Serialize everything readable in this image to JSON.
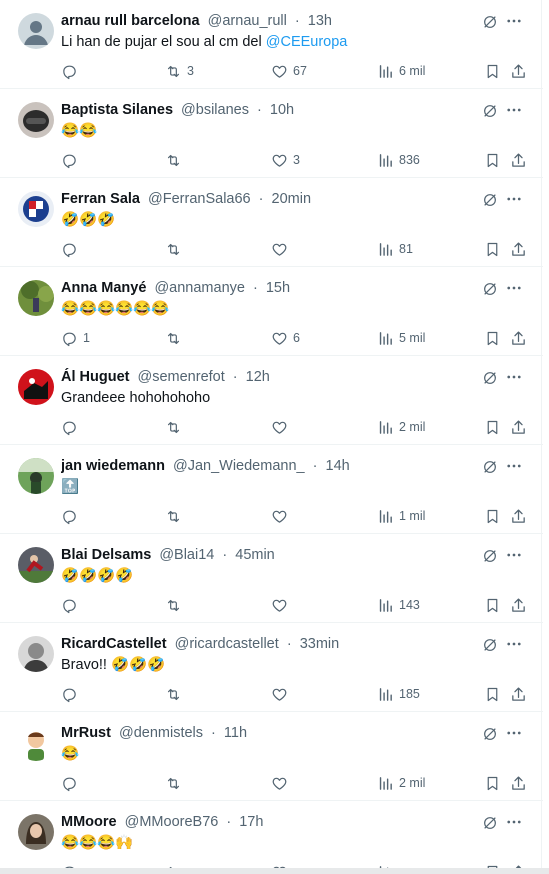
{
  "posts": [
    {
      "name": "arnau rull barcelona",
      "handle": "@arnau_rull",
      "dot": "·",
      "time": "13h",
      "text": "Li han de pujar el sou al cm del ",
      "mention": "@CEEuropa",
      "avatar": "default",
      "replies": "",
      "reposts": "3",
      "likes": "67",
      "views": "6 mil"
    },
    {
      "name": "Baptista Silanes",
      "handle": "@bsilanes",
      "dot": "·",
      "time": "10h",
      "text": "😂😂",
      "mention": "",
      "avatar": "helmet",
      "replies": "",
      "reposts": "",
      "likes": "3",
      "views": "836"
    },
    {
      "name": "Ferran Sala",
      "handle": "@FerranSala66",
      "dot": "·",
      "time": "20min",
      "text": "🤣🤣🤣",
      "mention": "",
      "avatar": "crest",
      "replies": "",
      "reposts": "",
      "likes": "",
      "views": "81"
    },
    {
      "name": "Anna Manyé",
      "handle": "@annamanye",
      "dot": "·",
      "time": "15h",
      "text": "😂😂😂😂😂😂",
      "mention": "",
      "avatar": "nature",
      "replies": "1",
      "reposts": "",
      "likes": "6",
      "views": "5 mil"
    },
    {
      "name": "Ál Huguet",
      "handle": "@semenrefot",
      "dot": "·",
      "time": "12h",
      "text": "Grandeee hohohohoho",
      "mention": "",
      "avatar": "red",
      "replies": "",
      "reposts": "",
      "likes": "",
      "views": "2 mil"
    },
    {
      "name": "jan wiedemann",
      "handle": "@Jan_Wiedemann_",
      "dot": "·",
      "time": "14h",
      "text": "🔝",
      "mention": "",
      "avatar": "field",
      "replies": "",
      "reposts": "",
      "likes": "",
      "views": "1 mil"
    },
    {
      "name": "Blai Delsams",
      "handle": "@Blai14",
      "dot": "·",
      "time": "45min",
      "text": "🤣🤣🤣🤣",
      "mention": "",
      "avatar": "action",
      "replies": "",
      "reposts": "",
      "likes": "",
      "views": "143"
    },
    {
      "name": "RicardCastellet",
      "handle": "@ricardcastellet",
      "dot": "·",
      "time": "33min",
      "text": "Bravo!! 🤣🤣🤣",
      "mention": "",
      "avatar": "bw",
      "replies": "",
      "reposts": "",
      "likes": "",
      "views": "185"
    },
    {
      "name": "MrRust",
      "handle": "@denmistels",
      "dot": "·",
      "time": "11h",
      "text": "😂",
      "mention": "",
      "avatar": "cartoon",
      "replies": "",
      "reposts": "",
      "likes": "",
      "views": "2 mil"
    },
    {
      "name": "MMoore",
      "handle": "@MMooreB76",
      "dot": "·",
      "time": "17h",
      "text": "😂😂😂🙌",
      "mention": "",
      "avatar": "woman",
      "replies": "",
      "reposts": "",
      "likes": "",
      "views": ""
    }
  ],
  "colors": {
    "text": "#0f1419",
    "secondary": "#536471",
    "link": "#1d9bf0",
    "divider": "#eff3f4"
  },
  "icons": {
    "reply": "reply-icon",
    "repost": "repost-icon",
    "like": "heart-icon",
    "views": "views-icon",
    "bookmark": "bookmark-icon",
    "share": "share-icon",
    "grok": "grok-icon",
    "more": "more-icon"
  }
}
